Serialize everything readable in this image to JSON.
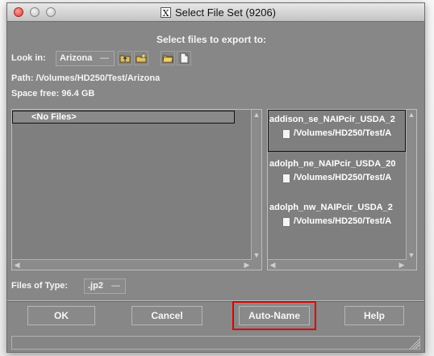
{
  "window": {
    "title": "Select File Set (9206)",
    "title_logo": "X"
  },
  "dialog": {
    "heading": "Select files to export to:",
    "look_in_label": "Look in:",
    "look_in_value": "Arizona",
    "path_label": "Path:",
    "path_value": "/Volumes/HD250/Test/Arizona",
    "space_label": "Space free:",
    "space_value": "96.4 GB",
    "left_list": {
      "items": [
        "<No Files>"
      ]
    },
    "right_list": {
      "items": [
        {
          "name": "addison_se_NAIPcir_USDA_2",
          "path": "/Volumes/HD250/Test/A"
        },
        {
          "name": "adolph_ne_NAIPcir_USDA_20",
          "path": "/Volumes/HD250/Test/A"
        },
        {
          "name": "adolph_nw_NAIPcir_USDA_2",
          "path": "/Volumes/HD250/Test/A"
        }
      ]
    },
    "files_type_label": "Files of Type:",
    "files_type_value": ".jp2",
    "buttons": {
      "ok": "OK",
      "cancel": "Cancel",
      "auto_name": "Auto-Name",
      "help": "Help"
    }
  },
  "icons": [
    "folder-up-icon",
    "new-folder-icon",
    "open-folder-icon",
    "new-document-icon",
    "document-icon"
  ],
  "colors": {
    "highlight": "#e00000"
  }
}
